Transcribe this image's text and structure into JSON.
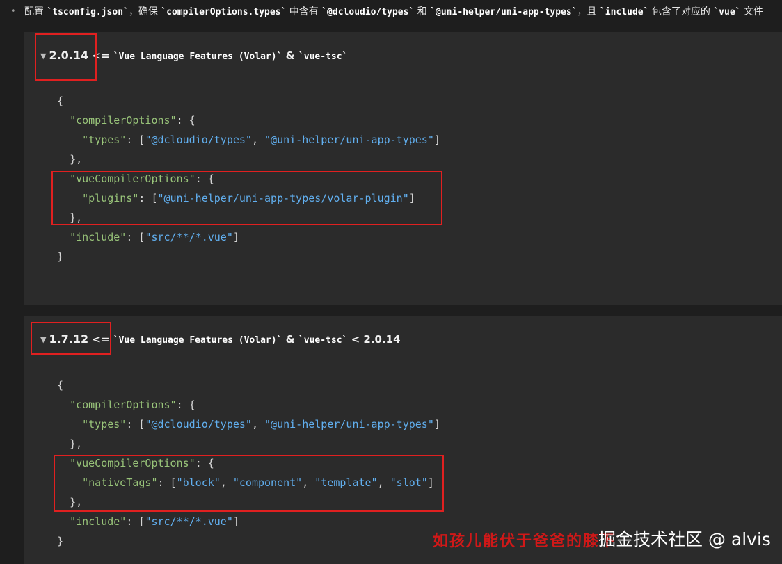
{
  "intro": {
    "bullet": "•",
    "prefix": "配置 ",
    "tsconfig": "`tsconfig.json`",
    "mid1": "，确保 ",
    "types_path": "`compilerOptions.types`",
    "mid2": " 中含有 ",
    "dcloudio": "`@dcloudio/types`",
    "mid3": " 和 ",
    "unihelper": "`@uni-helper/uni-app-types`",
    "mid4": "，且 ",
    "include": "`include`",
    "mid5": " 包含了对应的 ",
    "vue": "`vue`",
    "suffix": " 文件"
  },
  "section1": {
    "triangle": "▼",
    "version": "2.0.14",
    "op": " <= ",
    "tool1": "`Vue Language Features (Volar)`",
    "amp": " & ",
    "tool2": "`vue-tsc`",
    "tail": "",
    "code": {
      "l1": "{",
      "l2_key": "\"compilerOptions\"",
      "l2_rest": ": {",
      "l3_key": "\"types\"",
      "l3_mid": ": [",
      "l3_v1": "\"@dcloudio/types\"",
      "l3_sep": ", ",
      "l3_v2": "\"@uni-helper/uni-app-types\"",
      "l3_end": "]",
      "l4": "},",
      "l5_key": "\"vueCompilerOptions\"",
      "l5_rest": ": {",
      "l6_key": "\"plugins\"",
      "l6_mid": ": [",
      "l6_v1": "\"@uni-helper/uni-app-types/volar-plugin\"",
      "l6_end": "]",
      "l7": "},",
      "l8_key": "\"include\"",
      "l8_mid": ": [",
      "l8_v1": "\"src/**/*.vue\"",
      "l8_end": "]",
      "l9": "}"
    }
  },
  "section2": {
    "triangle": "▼",
    "version": "1.7.12",
    "op": " <= ",
    "tool1": "`Vue Language Features (Volar)`",
    "amp": " & ",
    "tool2": "`vue-tsc`",
    "tail": " < 2.0.14",
    "code": {
      "l1": "{",
      "l2_key": "\"compilerOptions\"",
      "l2_rest": ": {",
      "l3_key": "\"types\"",
      "l3_mid": ": [",
      "l3_v1": "\"@dcloudio/types\"",
      "l3_sep": ", ",
      "l3_v2": "\"@uni-helper/uni-app-types\"",
      "l3_end": "]",
      "l4": "},",
      "l5_key": "\"vueCompilerOptions\"",
      "l5_rest": ": {",
      "l6_key": "\"nativeTags\"",
      "l6_mid": ": [",
      "l6_v1": "\"block\"",
      "l6_v2": "\"component\"",
      "l6_v3": "\"template\"",
      "l6_v4": "\"slot\"",
      "l6_sep": ", ",
      "l6_end": "]",
      "l7": "},",
      "l8_key": "\"include\"",
      "l8_mid": ": [",
      "l8_v1": "\"src/**/*.vue\"",
      "l8_end": "]",
      "l9": "}"
    }
  },
  "overlay": {
    "red_caption": "如孩儿能伏于爸爸的膝下",
    "watermark": "掘金技术社区 @ alvis"
  },
  "colors": {
    "background": "#1e1e1e",
    "code_block": "#2b2b2b",
    "json_key": "#98c379",
    "json_string": "#61afef",
    "highlight_box": "#e02020"
  }
}
